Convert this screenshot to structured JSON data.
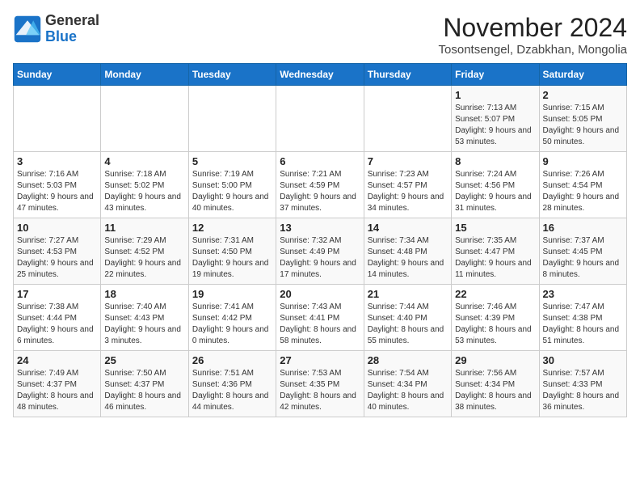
{
  "logo": {
    "line1": "General",
    "line2": "Blue"
  },
  "title": "November 2024",
  "location": "Tosontsengel, Dzabkhan, Mongolia",
  "weekdays": [
    "Sunday",
    "Monday",
    "Tuesday",
    "Wednesday",
    "Thursday",
    "Friday",
    "Saturday"
  ],
  "weeks": [
    [
      {
        "day": "",
        "info": ""
      },
      {
        "day": "",
        "info": ""
      },
      {
        "day": "",
        "info": ""
      },
      {
        "day": "",
        "info": ""
      },
      {
        "day": "",
        "info": ""
      },
      {
        "day": "1",
        "info": "Sunrise: 7:13 AM\nSunset: 5:07 PM\nDaylight: 9 hours and 53 minutes."
      },
      {
        "day": "2",
        "info": "Sunrise: 7:15 AM\nSunset: 5:05 PM\nDaylight: 9 hours and 50 minutes."
      }
    ],
    [
      {
        "day": "3",
        "info": "Sunrise: 7:16 AM\nSunset: 5:03 PM\nDaylight: 9 hours and 47 minutes."
      },
      {
        "day": "4",
        "info": "Sunrise: 7:18 AM\nSunset: 5:02 PM\nDaylight: 9 hours and 43 minutes."
      },
      {
        "day": "5",
        "info": "Sunrise: 7:19 AM\nSunset: 5:00 PM\nDaylight: 9 hours and 40 minutes."
      },
      {
        "day": "6",
        "info": "Sunrise: 7:21 AM\nSunset: 4:59 PM\nDaylight: 9 hours and 37 minutes."
      },
      {
        "day": "7",
        "info": "Sunrise: 7:23 AM\nSunset: 4:57 PM\nDaylight: 9 hours and 34 minutes."
      },
      {
        "day": "8",
        "info": "Sunrise: 7:24 AM\nSunset: 4:56 PM\nDaylight: 9 hours and 31 minutes."
      },
      {
        "day": "9",
        "info": "Sunrise: 7:26 AM\nSunset: 4:54 PM\nDaylight: 9 hours and 28 minutes."
      }
    ],
    [
      {
        "day": "10",
        "info": "Sunrise: 7:27 AM\nSunset: 4:53 PM\nDaylight: 9 hours and 25 minutes."
      },
      {
        "day": "11",
        "info": "Sunrise: 7:29 AM\nSunset: 4:52 PM\nDaylight: 9 hours and 22 minutes."
      },
      {
        "day": "12",
        "info": "Sunrise: 7:31 AM\nSunset: 4:50 PM\nDaylight: 9 hours and 19 minutes."
      },
      {
        "day": "13",
        "info": "Sunrise: 7:32 AM\nSunset: 4:49 PM\nDaylight: 9 hours and 17 minutes."
      },
      {
        "day": "14",
        "info": "Sunrise: 7:34 AM\nSunset: 4:48 PM\nDaylight: 9 hours and 14 minutes."
      },
      {
        "day": "15",
        "info": "Sunrise: 7:35 AM\nSunset: 4:47 PM\nDaylight: 9 hours and 11 minutes."
      },
      {
        "day": "16",
        "info": "Sunrise: 7:37 AM\nSunset: 4:45 PM\nDaylight: 9 hours and 8 minutes."
      }
    ],
    [
      {
        "day": "17",
        "info": "Sunrise: 7:38 AM\nSunset: 4:44 PM\nDaylight: 9 hours and 6 minutes."
      },
      {
        "day": "18",
        "info": "Sunrise: 7:40 AM\nSunset: 4:43 PM\nDaylight: 9 hours and 3 minutes."
      },
      {
        "day": "19",
        "info": "Sunrise: 7:41 AM\nSunset: 4:42 PM\nDaylight: 9 hours and 0 minutes."
      },
      {
        "day": "20",
        "info": "Sunrise: 7:43 AM\nSunset: 4:41 PM\nDaylight: 8 hours and 58 minutes."
      },
      {
        "day": "21",
        "info": "Sunrise: 7:44 AM\nSunset: 4:40 PM\nDaylight: 8 hours and 55 minutes."
      },
      {
        "day": "22",
        "info": "Sunrise: 7:46 AM\nSunset: 4:39 PM\nDaylight: 8 hours and 53 minutes."
      },
      {
        "day": "23",
        "info": "Sunrise: 7:47 AM\nSunset: 4:38 PM\nDaylight: 8 hours and 51 minutes."
      }
    ],
    [
      {
        "day": "24",
        "info": "Sunrise: 7:49 AM\nSunset: 4:37 PM\nDaylight: 8 hours and 48 minutes."
      },
      {
        "day": "25",
        "info": "Sunrise: 7:50 AM\nSunset: 4:37 PM\nDaylight: 8 hours and 46 minutes."
      },
      {
        "day": "26",
        "info": "Sunrise: 7:51 AM\nSunset: 4:36 PM\nDaylight: 8 hours and 44 minutes."
      },
      {
        "day": "27",
        "info": "Sunrise: 7:53 AM\nSunset: 4:35 PM\nDaylight: 8 hours and 42 minutes."
      },
      {
        "day": "28",
        "info": "Sunrise: 7:54 AM\nSunset: 4:34 PM\nDaylight: 8 hours and 40 minutes."
      },
      {
        "day": "29",
        "info": "Sunrise: 7:56 AM\nSunset: 4:34 PM\nDaylight: 8 hours and 38 minutes."
      },
      {
        "day": "30",
        "info": "Sunrise: 7:57 AM\nSunset: 4:33 PM\nDaylight: 8 hours and 36 minutes."
      }
    ]
  ]
}
